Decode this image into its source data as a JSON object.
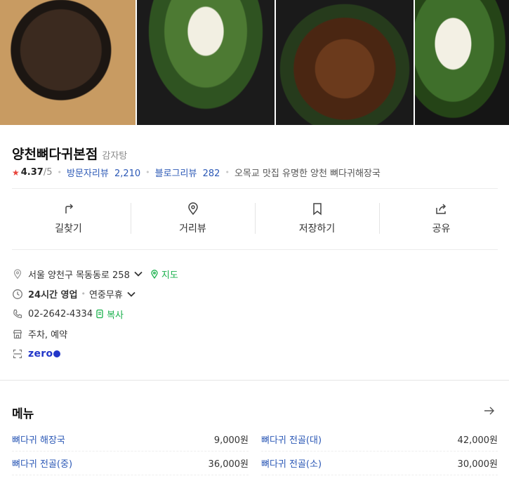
{
  "place": {
    "name": "양천뼈다귀본점",
    "category": "감자탕"
  },
  "rating": {
    "score": "4.37",
    "max": "/5"
  },
  "reviews": {
    "visitor_label": "방문자리뷰",
    "visitor_count": "2,210",
    "blog_label": "블로그리뷰",
    "blog_count": "282",
    "tagline": "오목교 맛집 유명한 양천 뼈다귀해장국"
  },
  "actions": [
    {
      "label": "길찾기",
      "icon": "directions-icon"
    },
    {
      "label": "거리뷰",
      "icon": "location-pin-icon"
    },
    {
      "label": "저장하기",
      "icon": "bookmark-icon"
    },
    {
      "label": "공유",
      "icon": "share-icon"
    }
  ],
  "info": {
    "address": "서울 양천구 목동동로 258",
    "map_label": "지도",
    "hours": "24시간 영업",
    "hours_note": "연중무휴",
    "phone": "02-2642-4334",
    "copy_label": "복사",
    "amenities": "주차, 예약",
    "zeropay_label": "zero"
  },
  "menu": {
    "title": "메뉴",
    "items": [
      {
        "name": "뼈다귀 해장국",
        "price": "9,000원"
      },
      {
        "name": "뼈다귀 전골(대)",
        "price": "42,000원"
      },
      {
        "name": "뼈다귀 전골(중)",
        "price": "36,000원"
      },
      {
        "name": "뼈다귀 전골(소)",
        "price": "30,000원"
      }
    ]
  },
  "colors": {
    "accent_blue": "#2b58b6",
    "accent_green": "#19b04b",
    "star_red": "#e8433a",
    "zeropay_blue": "#2236c9"
  }
}
